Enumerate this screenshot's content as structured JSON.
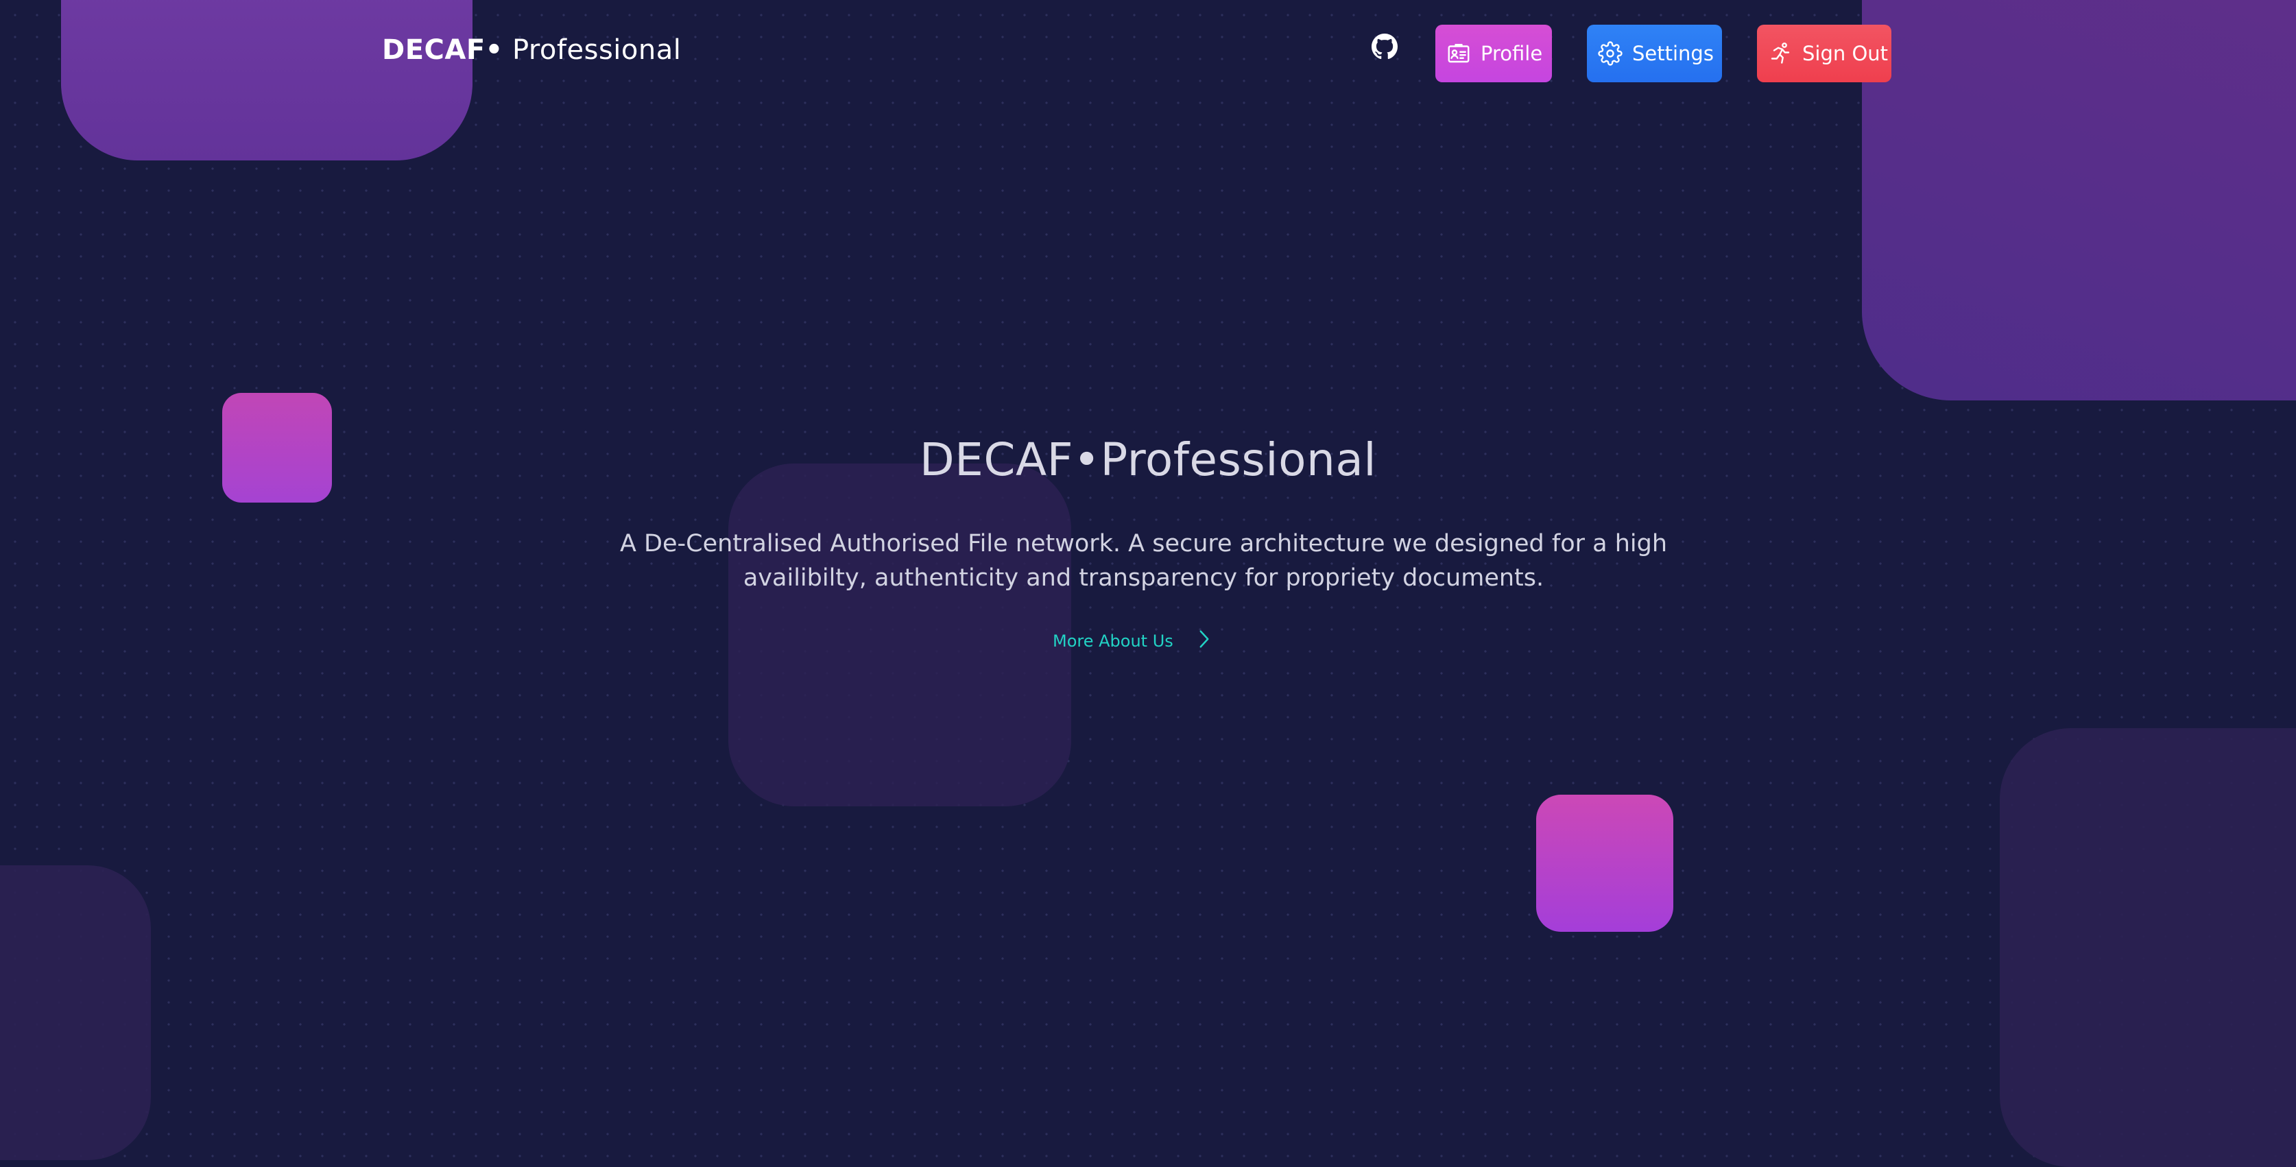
{
  "header": {
    "brand_bold": "DECAF•",
    "brand_light": " Professional",
    "github_icon": "github-icon",
    "buttons": {
      "profile": {
        "label": "Profile",
        "icon": "id-card-icon",
        "color": "#d64ed4"
      },
      "settings": {
        "label": "Settings",
        "icon": "gear-icon",
        "color": "#2f82f6"
      },
      "signout": {
        "label": "Sign Out",
        "icon": "running-person-icon",
        "color": "#f25462"
      }
    }
  },
  "hero": {
    "title": "DECAF•Professional",
    "description": "A De-Centralised Authorised File network. A secure architecture we designed for a high availibilty, authenticity and transparency for propriety documents.",
    "link_label": "More About Us",
    "link_icon": "chevron-right-icon",
    "link_color": "#22d3c5"
  },
  "theme": {
    "background": "#181a3f",
    "accent_pink": "#c146b6",
    "accent_purple": "#6e3aa2"
  }
}
